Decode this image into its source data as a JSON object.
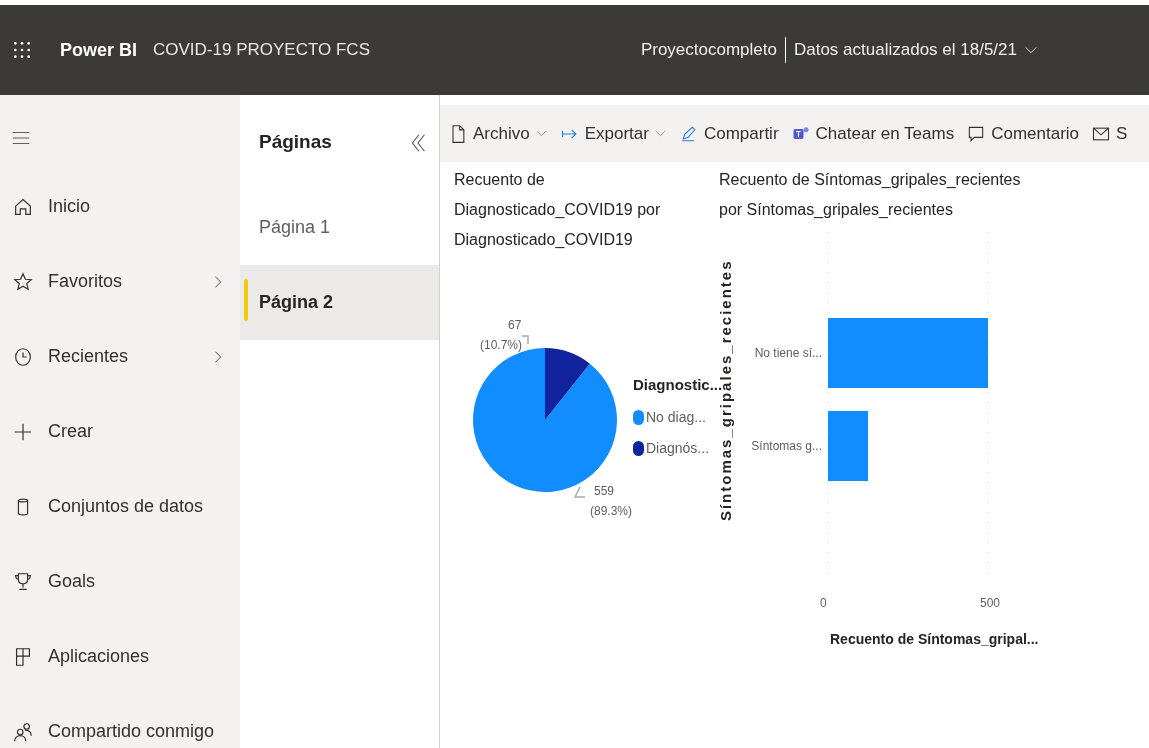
{
  "app_bar": {
    "product": "Power BI",
    "report_title": "COVID-19 PROYECTO FCS",
    "workspace": "Proyectocompleto",
    "updated": "Datos actualizados el 18/5/21"
  },
  "nav": [
    {
      "label": "Inicio",
      "expandable": false
    },
    {
      "label": "Favoritos",
      "expandable": true
    },
    {
      "label": "Recientes",
      "expandable": true
    },
    {
      "label": "Crear",
      "expandable": false
    },
    {
      "label": "Conjuntos de datos",
      "expandable": false
    },
    {
      "label": "Goals",
      "expandable": false
    },
    {
      "label": "Aplicaciones",
      "expandable": false
    },
    {
      "label": "Compartido conmigo",
      "expandable": false
    }
  ],
  "pages_panel": {
    "title": "Páginas",
    "pages": [
      {
        "label": "Página 1",
        "selected": false
      },
      {
        "label": "Página 2",
        "selected": true
      }
    ]
  },
  "toolbar": [
    {
      "label": "Archivo",
      "dropdown": true
    },
    {
      "label": "Exportar",
      "dropdown": true
    },
    {
      "label": "Compartir",
      "dropdown": false
    },
    {
      "label": "Chatear en Teams",
      "dropdown": false
    },
    {
      "label": "Comentario",
      "dropdown": false
    },
    {
      "label": "S",
      "dropdown": false
    }
  ],
  "pie_visual": {
    "title_lines": [
      "Recuento de",
      "Diagnosticado_COVID19 por",
      "Diagnosticado_COVID19"
    ],
    "legend": {
      "items": [
        {
          "color": "#118dff"
        },
        {
          "color": "#12239e"
        }
      ]
    },
    "data_labels": [
      {
        "value": "559",
        "percent": "(89.3%)"
      },
      {
        "value": "67",
        "percent": "(10.7%)"
      }
    ],
    "chart_data": {
      "type": "pie",
      "categories": [
        "No diag...",
        "Diagnós..."
      ],
      "values": [
        89.3,
        10.7
      ],
      "legend": {
        "title": "Diagnostic..."
      }
    }
  },
  "bar_visual": {
    "title_lines": [
      "Recuento de Síntomas_gripales_recientes",
      "por Síntomas_gripales_recientes"
    ],
    "chart_data": {
      "type": "bar",
      "orientation": "horizontal",
      "categories": [
        "No tiene sí...",
        "Síntomas g..."
      ],
      "series": [
        {
          "color": "#118dff",
          "values": [
            500,
            125
          ]
        }
      ],
      "xticks": [
        0,
        500
      ],
      "xlim": [
        0,
        500
      ],
      "xlabel": "Recuento de Síntomas_gripal...",
      "ylabel": "Síntomas_gripales_recientes"
    }
  }
}
